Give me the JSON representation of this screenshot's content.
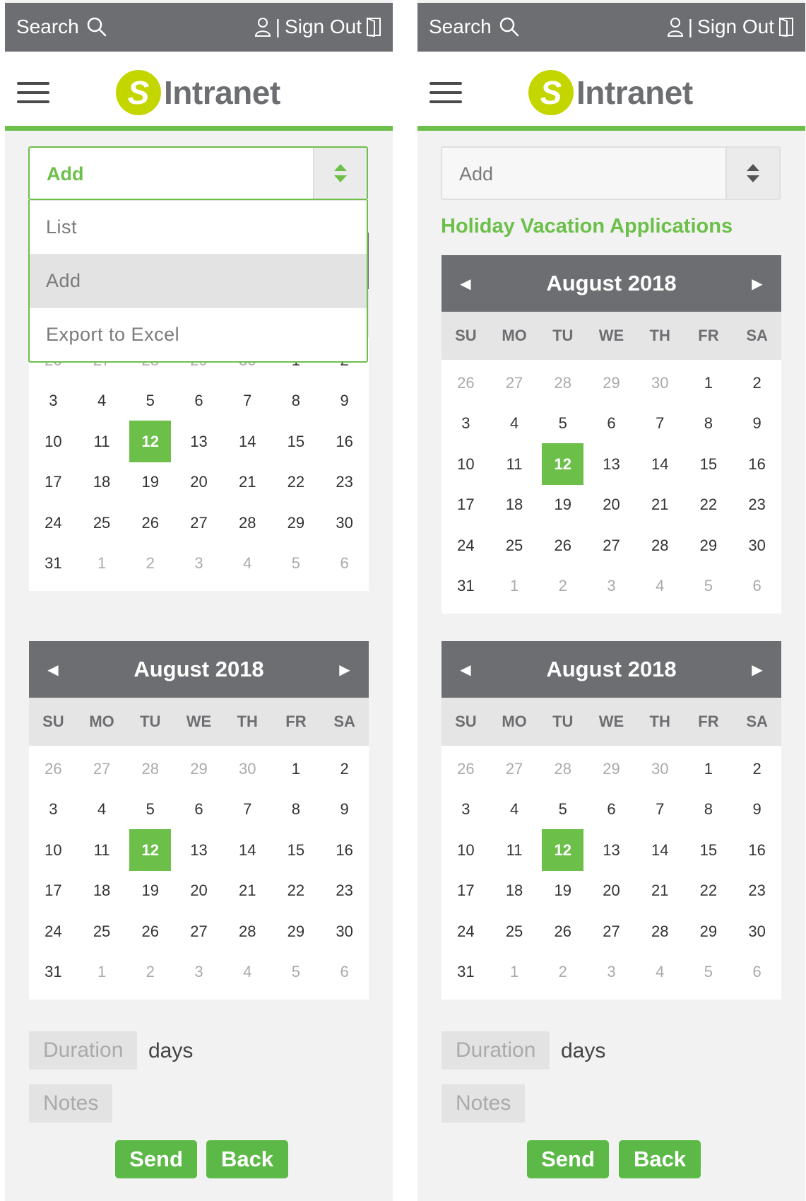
{
  "header": {
    "search_label": "Search",
    "sign_out_label": "Sign Out",
    "separator": "|"
  },
  "logo": {
    "letter": "S",
    "text": "Intranet"
  },
  "select": {
    "value": "Add",
    "options": [
      "List",
      "Add",
      "Export to Excel"
    ],
    "highlighted_option": "Add"
  },
  "page_title": "Holiday Vacation Applications",
  "calendar": {
    "month_label": "August 2018",
    "prev_symbol": "◀",
    "next_symbol": "▶",
    "weekdays": [
      "SU",
      "MO",
      "TU",
      "WE",
      "TH",
      "FR",
      "SA"
    ],
    "days": [
      {
        "d": "26",
        "other": true
      },
      {
        "d": "27",
        "other": true
      },
      {
        "d": "28",
        "other": true
      },
      {
        "d": "29",
        "other": true
      },
      {
        "d": "30",
        "other": true
      },
      {
        "d": "1"
      },
      {
        "d": "2"
      },
      {
        "d": "3"
      },
      {
        "d": "4"
      },
      {
        "d": "5"
      },
      {
        "d": "6"
      },
      {
        "d": "7"
      },
      {
        "d": "8"
      },
      {
        "d": "9"
      },
      {
        "d": "10"
      },
      {
        "d": "11"
      },
      {
        "d": "12",
        "today": true
      },
      {
        "d": "13"
      },
      {
        "d": "14"
      },
      {
        "d": "15"
      },
      {
        "d": "16"
      },
      {
        "d": "17"
      },
      {
        "d": "18"
      },
      {
        "d": "19"
      },
      {
        "d": "20"
      },
      {
        "d": "21"
      },
      {
        "d": "22"
      },
      {
        "d": "23"
      },
      {
        "d": "24"
      },
      {
        "d": "25"
      },
      {
        "d": "26"
      },
      {
        "d": "27"
      },
      {
        "d": "28"
      },
      {
        "d": "29"
      },
      {
        "d": "30"
      },
      {
        "d": "31"
      },
      {
        "d": "1",
        "other": true
      },
      {
        "d": "2",
        "other": true
      },
      {
        "d": "3",
        "other": true
      },
      {
        "d": "4",
        "other": true
      },
      {
        "d": "5",
        "other": true
      },
      {
        "d": "6",
        "other": true
      }
    ]
  },
  "form": {
    "duration_placeholder": "Duration",
    "duration_unit": "days",
    "notes_placeholder": "Notes",
    "send_label": "Send",
    "back_label": "Back"
  },
  "colors": {
    "accent_green": "#6cc04a",
    "header_gray": "#6d6e71",
    "logo_lime": "#c4d600"
  },
  "icons": {
    "search": "search-icon",
    "user": "user-icon",
    "sign_out": "door-exit-icon",
    "menu": "hamburger-menu-icon",
    "select_arrows": "up-down-arrows-icon",
    "prev": "caret-left-icon",
    "next": "caret-right-icon"
  }
}
